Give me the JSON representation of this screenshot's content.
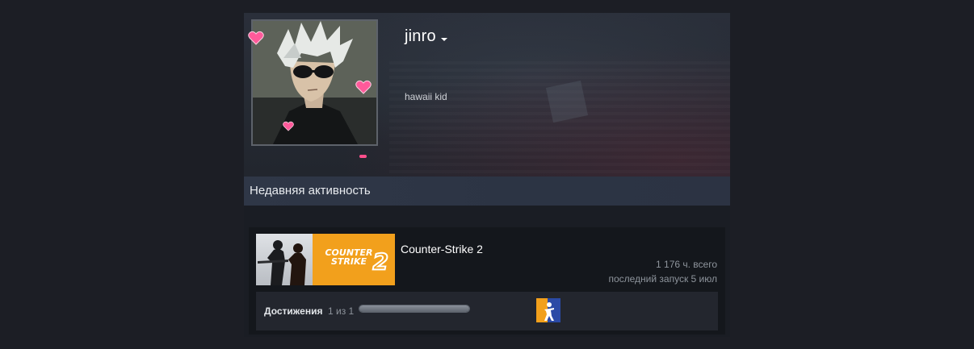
{
  "profile": {
    "username": "jinro",
    "status_text": "hawaii kid",
    "avatar": "anime-avatar-white-hair-sunglasses",
    "frame_decoration": "pink-hearts"
  },
  "activity": {
    "title": "Недавняя активность"
  },
  "game": {
    "name": "Counter-Strike 2",
    "capsule_logo_line1": "COUNTER",
    "capsule_logo_line2": "STRIKE",
    "capsule_logo_number": "2",
    "hours_total": "1 176 ч. всего",
    "last_played": "последний запуск 5 июл",
    "achievements": {
      "label": "Достижения",
      "count": "1 из 1",
      "progress_fraction": 1.0,
      "icon": "cs-achievement-icon"
    }
  },
  "colors": {
    "page_bg": "#1c1e25",
    "activity_bar": "#2f3747",
    "capsule_orange": "#f2a01c",
    "heart_pink": "#ff5a9a"
  }
}
